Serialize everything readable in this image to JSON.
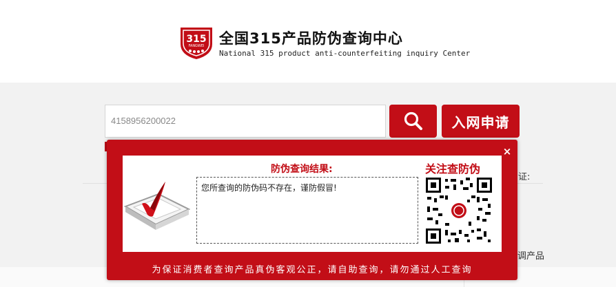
{
  "header": {
    "logo_number": "315",
    "logo_brand": "FANGWEI",
    "title": "全国315产品防伪查询中心",
    "subtitle": "National 315 product anti-counterfeiting inquiry Center"
  },
  "search": {
    "value": "4158956200022",
    "search_icon": "magnifier-icon",
    "apply_label": "入网申请"
  },
  "background_text": {
    "right_top": "证:",
    "right_bottom": "调产品"
  },
  "modal": {
    "close_label": "×",
    "result_title": "防伪查询结果:",
    "result_message": "您所查询的防伪码不存在，谨防假冒!",
    "follow_title": "关注查防伪",
    "footer_note": "为保证消费者查询产品真伪客观公正，请自助查询，请勿通过人工查询"
  },
  "colors": {
    "brand_red": "#c20e17",
    "background": "#f2f2f2"
  }
}
